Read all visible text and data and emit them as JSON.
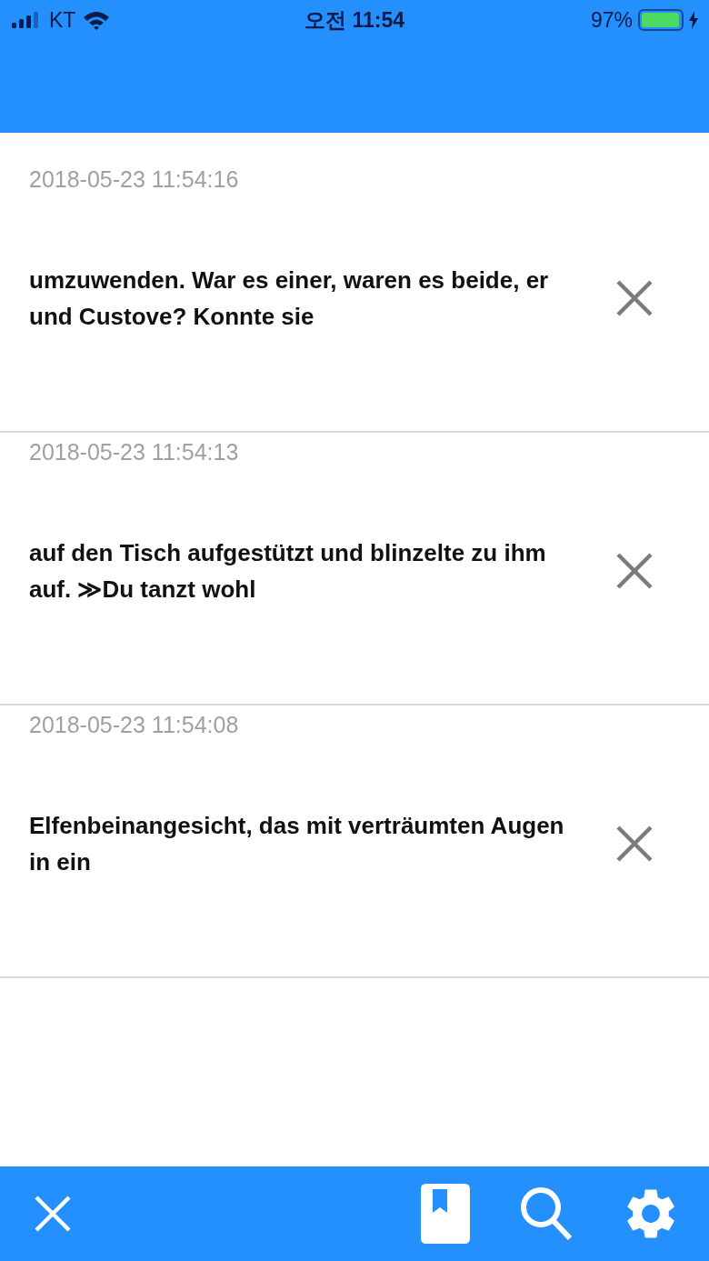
{
  "status_bar": {
    "carrier": "KT",
    "time": "오전 11:54",
    "battery_percent": "97%",
    "battery": {
      "level": 0.97,
      "charging": true
    }
  },
  "entries": [
    {
      "timestamp": "2018-05-23 11:54:16",
      "text": "umzuwenden. War es einer, waren es beide, er und Custove? Konnte sie"
    },
    {
      "timestamp": "2018-05-23 11:54:13",
      "text": "auf den Tisch aufgestützt und blinzelte zu ihm auf. ≫Du tanzt wohl"
    },
    {
      "timestamp": "2018-05-23 11:54:08",
      "text": "Elfenbeinangesicht, das mit verträumten Augen in ein"
    }
  ]
}
